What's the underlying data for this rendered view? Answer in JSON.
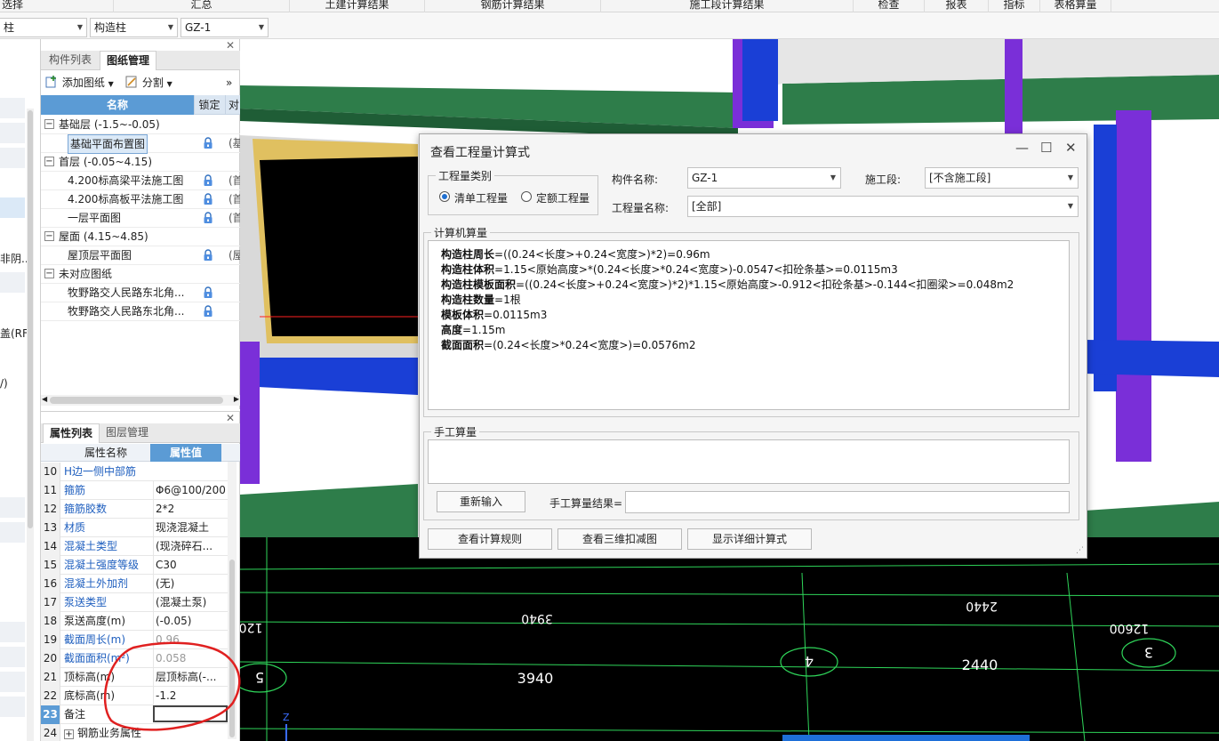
{
  "ribbon": {
    "tabs": [
      "选择",
      "汇总",
      "土建计算结果",
      "钢筋计算结果",
      "施工段计算结果",
      "检查",
      "报表",
      "指标",
      "表格算量"
    ]
  },
  "selectors": {
    "floor": "柱",
    "type": "构造柱",
    "component": "GZ-1"
  },
  "left_strip": {
    "fragments": [
      "非阴...",
      "盖(RF)",
      "/)"
    ]
  },
  "drawing_panel": {
    "tabs": [
      "构件列表",
      "图纸管理"
    ],
    "active_tab": "图纸管理",
    "toolbar": {
      "add": "添加图纸",
      "split": "分割",
      "more": "»"
    },
    "columns": {
      "name": "名称",
      "lock": "锁定",
      "extra": "对"
    },
    "rows": [
      {
        "text": "基础层 (-1.5~-0.05)",
        "level": 0,
        "expand": "−"
      },
      {
        "text": "基础平面布置图",
        "level": 1,
        "lock": true,
        "tail": "(基",
        "selected": true
      },
      {
        "text": "首层 (-0.05~4.15)",
        "level": 0,
        "expand": "−"
      },
      {
        "text": "4.200标高梁平法施工图",
        "level": 1,
        "lock": true,
        "tail": "(首"
      },
      {
        "text": "4.200标高板平法施工图",
        "level": 1,
        "lock": true,
        "tail": "(首"
      },
      {
        "text": "一层平面图",
        "level": 1,
        "lock": true,
        "tail": "(首"
      },
      {
        "text": "屋面 (4.15~4.85)",
        "level": 0,
        "expand": "−"
      },
      {
        "text": "屋顶层平面图",
        "level": 1,
        "lock": true,
        "tail": "(屋"
      },
      {
        "text": "未对应图纸",
        "level": 0,
        "expand": "−"
      },
      {
        "text": "牧野路交人民路东北角...",
        "level": 1,
        "lock": true,
        "tail": ""
      },
      {
        "text": "牧野路交人民路东北角...",
        "level": 1,
        "lock": true,
        "tail": ""
      }
    ]
  },
  "property_panel": {
    "tabs": [
      "属性列表",
      "图层管理"
    ],
    "active_tab": "属性列表",
    "columns": {
      "name": "属性名称",
      "value": "属性值"
    },
    "rows": [
      {
        "num": "10",
        "name": "H边一侧中部筋",
        "value": "",
        "blue": true
      },
      {
        "num": "11",
        "name": "箍筋",
        "value": "Φ6@100/200",
        "blue": true
      },
      {
        "num": "12",
        "name": "箍筋胶数",
        "value": "2*2",
        "blue": true
      },
      {
        "num": "13",
        "name": "材质",
        "value": "现浇混凝土",
        "blue": true
      },
      {
        "num": "14",
        "name": "混凝土类型",
        "value": "(现浇碎石...",
        "blue": true
      },
      {
        "num": "15",
        "name": "混凝土强度等级",
        "value": "C30",
        "blue": true
      },
      {
        "num": "16",
        "name": "混凝土外加剂",
        "value": "(无)",
        "blue": true
      },
      {
        "num": "17",
        "name": "泵送类型",
        "value": "(混凝土泵)",
        "blue": true
      },
      {
        "num": "18",
        "name": "泵送高度(m)",
        "value": "(-0.05)",
        "blue": false
      },
      {
        "num": "19",
        "name": "截面周长(m)",
        "value": "0.96",
        "blue": true,
        "gray": true
      },
      {
        "num": "20",
        "name": "截面面积(m²)",
        "value": "0.058",
        "blue": true,
        "gray": true
      },
      {
        "num": "21",
        "name": "顶标高(m)",
        "value": "层顶标高(-...",
        "blue": false
      },
      {
        "num": "22",
        "name": "底标高(m)",
        "value": "-1.2",
        "blue": false
      },
      {
        "num": "23",
        "name": "备注",
        "value": "",
        "blue": false,
        "selected": true
      },
      {
        "num": "24",
        "name": "钢筋业务属性",
        "value": "",
        "blue": false,
        "expand": "+"
      }
    ]
  },
  "viewport": {
    "dimensions": [
      "3940",
      "2440",
      "12600",
      "120"
    ],
    "dimensions_mirrored": [
      "3940",
      "2440"
    ],
    "axis_labels": [
      "5",
      "4",
      "3"
    ],
    "axis_z": "Z",
    "colors": {
      "beam_green": "#2e7d4a",
      "slab_gray": "#d6d6d6",
      "wall_blue": "#1a3fd6",
      "column_purple": "#7a2fd8",
      "grid_line": "#2fd65a",
      "frame_yellow": "#e0c060"
    }
  },
  "dialog": {
    "title": "查看工程量计算式",
    "controls": [
      "—",
      "☐",
      "✕"
    ],
    "quantity_type_legend": "工程量类别",
    "radio_bill": "清单工程量",
    "radio_quota": "定额工程量",
    "radio_selected": "清单工程量",
    "component_name_label": "构件名称:",
    "component_name_value": "GZ-1",
    "section_label": "施工段:",
    "section_value": "[不含施工段]",
    "quantity_name_label": "工程量名称:",
    "quantity_name_value": "[全部]",
    "computer_legend": "计算机算量",
    "calc_lines": [
      {
        "label": "构造柱周长",
        "formula": "=((0.24<长度>+0.24<宽度>)*2)=0.96m"
      },
      {
        "label": "构造柱体积",
        "formula": "=1.15<原始高度>*(0.24<长度>*0.24<宽度>)-0.0547<扣砼条基>=0.0115m3"
      },
      {
        "label": "构造柱模板面积",
        "formula": "=((0.24<长度>+0.24<宽度>)*2)*1.15<原始高度>-0.912<扣砼条基>-0.144<扣圈梁>=0.048m2"
      },
      {
        "label": "构造柱数量",
        "formula": "=1根"
      },
      {
        "label": "模板体积",
        "formula": "=0.0115m3"
      },
      {
        "label": "高度",
        "formula": "=1.15m"
      },
      {
        "label": "截面面积",
        "formula": "=(0.24<长度>*0.24<宽度>)=0.0576m2"
      }
    ],
    "manual_legend": "手工算量",
    "reenter_button": "重新输入",
    "manual_result_label": "手工算量结果=",
    "manual_result_value": "",
    "buttons": [
      "查看计算规则",
      "查看三维扣减图",
      "显示详细计算式"
    ]
  },
  "annotation_color": "#e02020"
}
